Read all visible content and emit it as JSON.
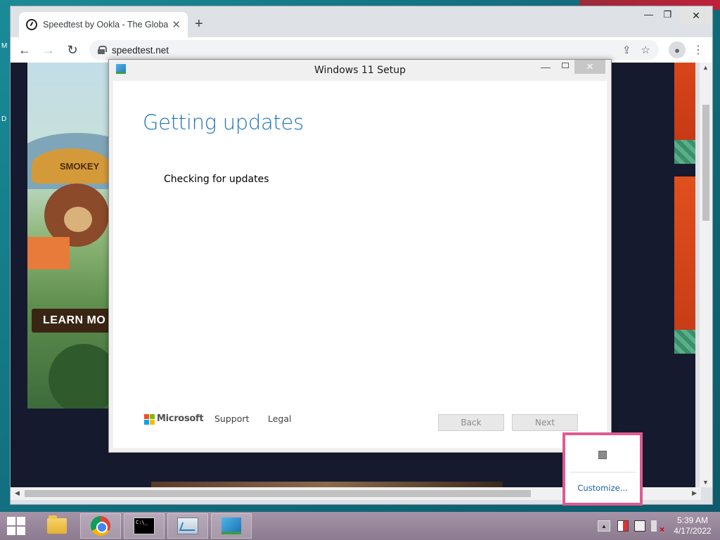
{
  "browser": {
    "tab_title": "Speedtest by Ookla - The Global",
    "url": "speedtest.net",
    "icons": [
      "back-arrow-icon",
      "forward-arrow-icon",
      "reload-icon",
      "lock-icon",
      "share-icon",
      "star-icon",
      "profile-icon",
      "menu-icon"
    ]
  },
  "page": {
    "ad_left": {
      "hat_text": "SMOKEY",
      "cta": "LEARN MO"
    }
  },
  "setup": {
    "title": "Windows 11 Setup",
    "heading": "Getting updates",
    "status": "Checking for updates",
    "brand": "Microsoft",
    "support_link": "Support",
    "legal_link": "Legal",
    "back_button": "Back",
    "next_button": "Next"
  },
  "tray_popup": {
    "customize_link": "Customize..."
  },
  "taskbar": {
    "items": [
      "file-explorer",
      "chrome",
      "command-prompt",
      "resource-monitor",
      "windows-11-setup"
    ],
    "clock_time": "5:39 AM",
    "clock_date": "4/17/2022"
  },
  "colors": {
    "setup_heading": "#1e73b8",
    "highlight_border": "#e05a92",
    "taskbar": "#9c8aa0"
  }
}
